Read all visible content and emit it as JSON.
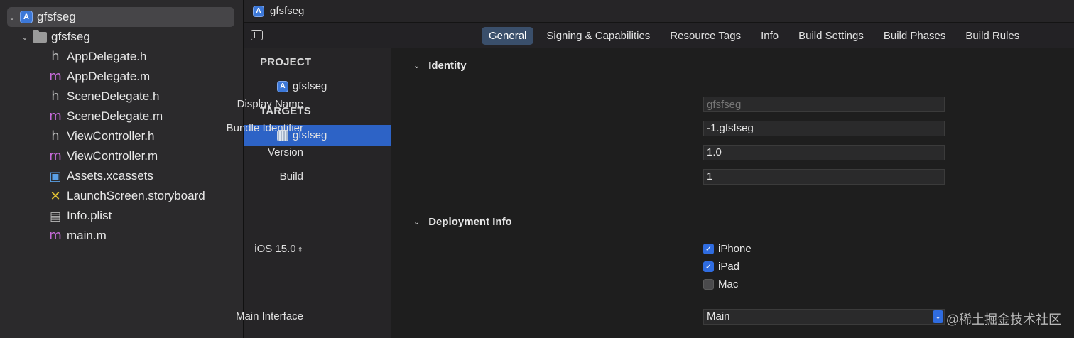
{
  "navigator": {
    "items": [
      {
        "label": "gfsfseg",
        "icon": "app-project-icon",
        "disclosure": "⌄"
      },
      {
        "label": "gfsfseg",
        "icon": "folder-icon",
        "disclosure": "⌄"
      },
      {
        "label": "AppDelegate.h",
        "icon": "h"
      },
      {
        "label": "AppDelegate.m",
        "icon": "m"
      },
      {
        "label": "SceneDelegate.h",
        "icon": "h"
      },
      {
        "label": "SceneDelegate.m",
        "icon": "m"
      },
      {
        "label": "ViewController.h",
        "icon": "h"
      },
      {
        "label": "ViewController.m",
        "icon": "m"
      },
      {
        "label": "Assets.xcassets",
        "icon": "assets-icon"
      },
      {
        "label": "LaunchScreen.storyboard",
        "icon": "storyboard-icon"
      },
      {
        "label": "Info.plist",
        "icon": "plist-icon"
      },
      {
        "label": "main.m",
        "icon": "m"
      }
    ]
  },
  "topbar": {
    "title": "gfsfseg"
  },
  "tabs": [
    "General",
    "Signing & Capabilities",
    "Resource Tags",
    "Info",
    "Build Settings",
    "Build Phases",
    "Build Rules"
  ],
  "projects": {
    "project_header": "PROJECT",
    "project_item": "gfsfseg",
    "targets_header": "TARGETS",
    "target_item": "gfsfseg"
  },
  "identity": {
    "title": "Identity",
    "display_name_label": "Display Name",
    "display_name_placeholder": "gfsfseg",
    "bundle_identifier_label": "Bundle Identifier",
    "bundle_identifier_value": "-1.gfsfseg",
    "version_label": "Version",
    "version_value": "1.0",
    "build_label": "Build",
    "build_value": "1"
  },
  "deployment": {
    "title": "Deployment Info",
    "ios_version": "iOS 15.0",
    "stepper_glyph": "⌃⌄",
    "iphone_label": "iPhone",
    "iphone_checked": true,
    "ipad_label": "iPad",
    "ipad_checked": true,
    "mac_label": "Mac",
    "mac_checked": false,
    "main_interface_label": "Main Interface",
    "main_interface_value": "Main"
  },
  "watermark": "@稀土掘金技术社区",
  "colors": {
    "accent": "#2f6ce0",
    "selection": "#2d63c6"
  }
}
